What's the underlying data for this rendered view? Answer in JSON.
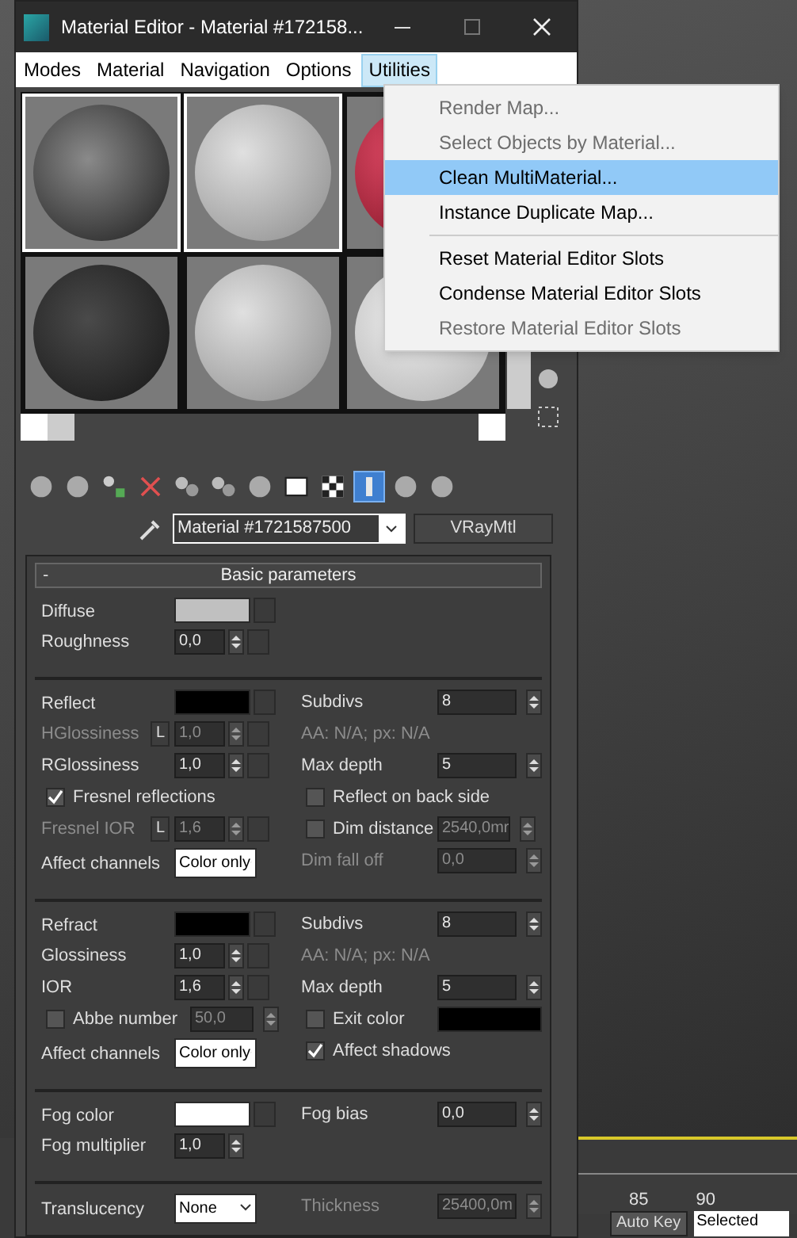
{
  "window": {
    "title": "Material Editor - Material #172158..."
  },
  "menu": [
    {
      "label": "Modes",
      "selected": false
    },
    {
      "label": "Material",
      "selected": false
    },
    {
      "label": "Navigation",
      "selected": false
    },
    {
      "label": "Options",
      "selected": false
    },
    {
      "label": "Utilities",
      "selected": true
    }
  ],
  "dropdown": {
    "groups": [
      [
        {
          "label": "Render Map...",
          "disabled": true,
          "selected": false
        },
        {
          "label": "Select Objects by Material...",
          "disabled": true,
          "selected": false
        },
        {
          "label": "Clean MultiMaterial...",
          "disabled": false,
          "selected": true
        },
        {
          "label": "Instance Duplicate Map...",
          "disabled": false,
          "selected": false
        }
      ],
      [
        {
          "label": "Reset Material Editor Slots",
          "disabled": false,
          "selected": false
        },
        {
          "label": "Condense Material Editor Slots",
          "disabled": false,
          "selected": false
        },
        {
          "label": "Restore Material Editor Slots",
          "disabled": true,
          "selected": false
        }
      ]
    ]
  },
  "slots": [
    {
      "kind": "textured",
      "selected": true
    },
    {
      "kind": "plain",
      "selected": true
    },
    {
      "kind": "red",
      "selected": false
    },
    {
      "kind": "mesh",
      "selected": false
    },
    {
      "kind": "plain",
      "selected": false
    },
    {
      "kind": "light",
      "selected": false
    }
  ],
  "material": {
    "name": "Material #1721587500",
    "type": "VRayMtl"
  },
  "rollout": {
    "title": "Basic parameters",
    "collapse": "-",
    "sections": [
      [
        {
          "left": {
            "kind": "color",
            "label": "Diffuse",
            "color": "#c0c0c0",
            "map": true
          }
        },
        {
          "left": {
            "kind": "spinner",
            "label": "Roughness",
            "value": "0,0",
            "map": true,
            "disabled": false
          }
        }
      ],
      [
        {
          "left": {
            "kind": "color",
            "label": "Reflect",
            "color": "#000000",
            "map": true
          },
          "right": {
            "kind": "spinner",
            "label": "Subdivs",
            "value": "8",
            "disabled": false
          }
        },
        {
          "left": {
            "kind": "spinner",
            "label": "HGlossiness",
            "lock": "L",
            "value": "1,0",
            "map": true,
            "disabled": true
          },
          "right": {
            "kind": "text",
            "label": "AA: N/A; px: N/A"
          }
        },
        {
          "left": {
            "kind": "spinner",
            "label": "RGlossiness",
            "value": "1,0",
            "map": true,
            "disabled": false
          },
          "right": {
            "kind": "spinner",
            "label": "Max depth",
            "value": "5",
            "disabled": false
          }
        },
        {
          "left": {
            "kind": "check",
            "label": "Fresnel reflections",
            "checked": true
          },
          "right": {
            "kind": "check",
            "label": "Reflect on back side",
            "checked": false
          }
        },
        {
          "left": {
            "kind": "spinner",
            "label": "Fresnel IOR",
            "lock": "L",
            "value": "1,6",
            "map": true,
            "disabled": true
          },
          "right": {
            "kind": "checkspinner",
            "label": "Dim distance",
            "checked": false,
            "value": "2540,0mr",
            "disabled": true
          }
        },
        {
          "left": {
            "kind": "dropdown",
            "label": "Affect channels",
            "value": "Color only"
          },
          "right": {
            "kind": "spinner",
            "label": "Dim fall off",
            "value": "0,0",
            "disabled": true
          }
        }
      ],
      [
        {
          "left": {
            "kind": "color",
            "label": "Refract",
            "color": "#000000",
            "map": true
          },
          "right": {
            "kind": "spinner",
            "label": "Subdivs",
            "value": "8",
            "disabled": false
          }
        },
        {
          "left": {
            "kind": "spinner",
            "label": "Glossiness",
            "value": "1,0",
            "map": true,
            "disabled": false
          },
          "right": {
            "kind": "text",
            "label": "AA: N/A; px: N/A"
          }
        },
        {
          "left": {
            "kind": "spinner",
            "label": "IOR",
            "value": "1,6",
            "map": true,
            "disabled": false
          },
          "right": {
            "kind": "spinner",
            "label": "Max depth",
            "value": "5",
            "disabled": false
          }
        },
        {
          "left": {
            "kind": "checkspinner",
            "label": "Abbe number",
            "checked": false,
            "value": "50,0",
            "disabled": true
          },
          "right": {
            "kind": "checkcolor",
            "label": "Exit color",
            "checked": false,
            "color": "#000000"
          }
        },
        {
          "left": {
            "kind": "dropdown",
            "label": "Affect channels",
            "value": "Color only"
          },
          "right": {
            "kind": "check",
            "label": "Affect shadows",
            "checked": true
          }
        }
      ],
      [
        {
          "left": {
            "kind": "color",
            "label": "Fog color",
            "color": "#ffffff",
            "map": true
          },
          "right": {
            "kind": "spinner",
            "label": "Fog bias",
            "value": "0,0",
            "disabled": false
          }
        },
        {
          "left": {
            "kind": "spinner",
            "label": "Fog multiplier",
            "value": "1,0",
            "map": false,
            "disabled": false
          }
        }
      ],
      [
        {
          "left": {
            "kind": "dropdown",
            "label": "Translucency",
            "value": "None"
          },
          "right": {
            "kind": "spinner",
            "label": "Thickness",
            "value": "25400,0m",
            "disabled": true
          }
        }
      ]
    ]
  },
  "timeline": {
    "labels": [
      "85",
      "90"
    ]
  },
  "status": {
    "auto_key": "Auto Key",
    "selection": "Selected"
  }
}
